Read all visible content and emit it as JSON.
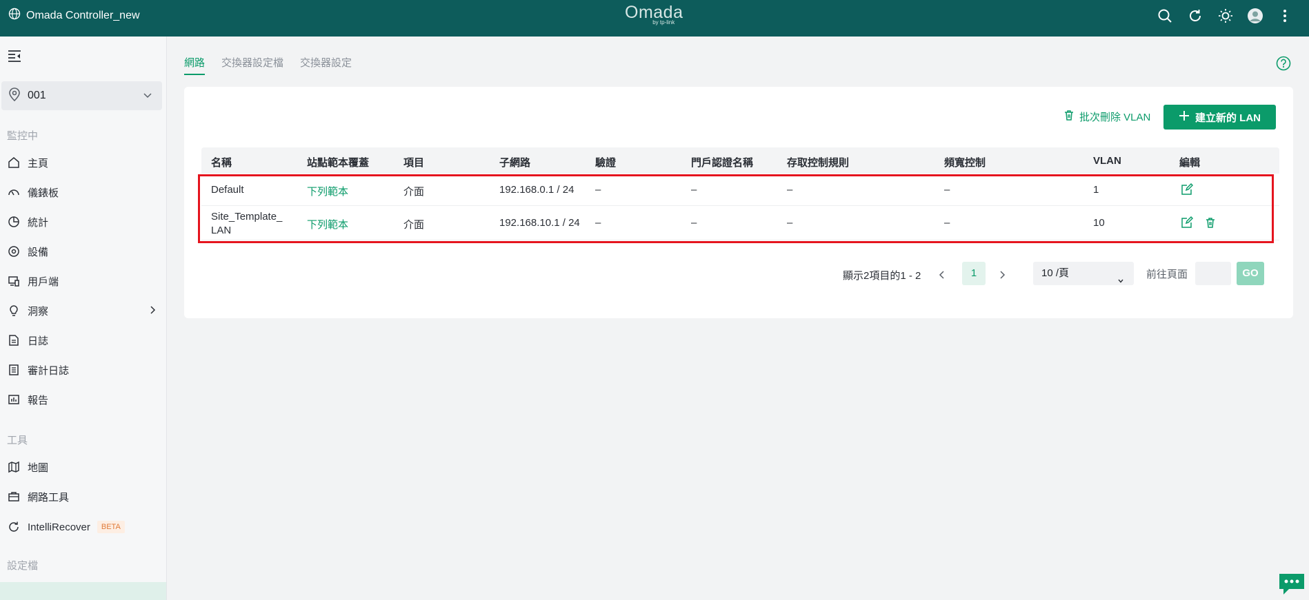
{
  "header": {
    "site_name": "Omada Controller_new",
    "logo_text": "Omada",
    "logo_sub": "by tp-link",
    "icons": [
      "globe-icon",
      "search-icon",
      "refresh-icon",
      "theme-icon",
      "avatar",
      "more-icon"
    ]
  },
  "sidebar": {
    "site_selector": "001",
    "section_monitor": "監控中",
    "items": [
      {
        "label": "主頁",
        "icon": "home-icon"
      },
      {
        "label": "儀錶板",
        "icon": "dashboard-icon"
      },
      {
        "label": "統計",
        "icon": "statistics-icon"
      },
      {
        "label": "設備",
        "icon": "devices-icon"
      },
      {
        "label": "用戶端",
        "icon": "clients-icon"
      },
      {
        "label": "洞察",
        "icon": "insights-icon"
      },
      {
        "label": "日誌",
        "icon": "logs-icon"
      },
      {
        "label": "審計日誌",
        "icon": "audit-log-icon"
      },
      {
        "label": "報告",
        "icon": "report-icon"
      }
    ],
    "section_tools": "工具",
    "tools": [
      {
        "label": "地圖",
        "icon": "map-icon"
      },
      {
        "label": "網路工具",
        "icon": "network-tools-icon"
      },
      {
        "label": "IntelliRecover",
        "icon": "intellirecover-icon",
        "badge": "BETA"
      }
    ],
    "section_profiles": "設定檔"
  },
  "tabs": [
    "網路",
    "交換器設定檔",
    "交換器設定"
  ],
  "toolbar": {
    "batch_delete": "批次刪除 VLAN",
    "create_lan": "建立新的 LAN"
  },
  "table": {
    "columns": [
      "名稱",
      "站點範本覆蓋",
      "項目",
      "子網路",
      "驗證",
      "門戶認證名稱",
      "存取控制規則",
      "頻寬控制",
      "VLAN",
      "編輯"
    ],
    "rows": [
      {
        "name": "Default",
        "override": "下列範本",
        "item": "介面",
        "subnet": "192.168.0.1 / 24",
        "auth": "–",
        "portal": "–",
        "acl": "–",
        "bandwidth": "–",
        "vlan": "1"
      },
      {
        "name": "Site_Template_\nLAN",
        "override": "下列範本",
        "item": "介面",
        "subnet": "192.168.10.1 / 24",
        "auth": "–",
        "portal": "–",
        "acl": "–",
        "bandwidth": "–",
        "vlan": "10"
      }
    ]
  },
  "pagination": {
    "summary": "顯示2項目的1 - 2",
    "current_page": "1",
    "page_size": "10 /頁",
    "goto_label": "前往頁面",
    "go_label": "GO"
  },
  "colors": {
    "topbar": "#0d5c5b",
    "accent": "#0b9b6a",
    "highlight": "#e5141e"
  }
}
